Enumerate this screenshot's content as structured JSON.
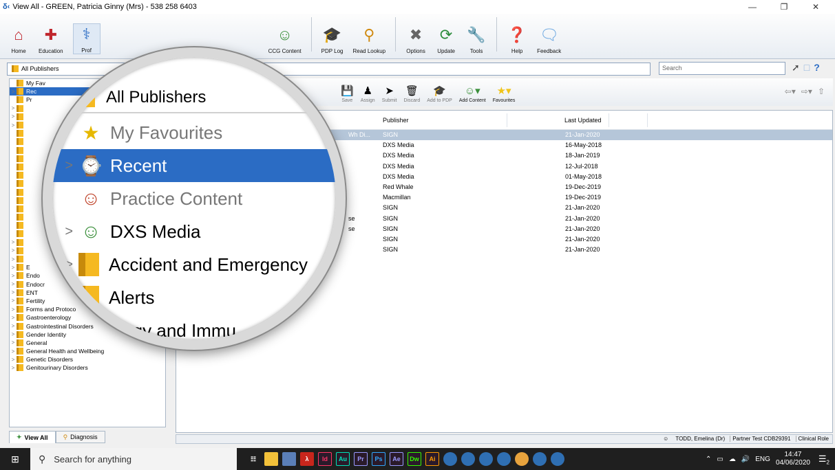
{
  "window": {
    "title": "View All  -  GREEN, Patricia Ginny (Mrs) - 538 258 6403",
    "app_logo": "δ‹"
  },
  "toolbar": {
    "buttons": [
      {
        "label": "Home",
        "icon": "home-icon"
      },
      {
        "label": "Education",
        "icon": "education-icon"
      },
      {
        "label": "Prof",
        "icon": "professional-icon"
      },
      {
        "label": "CCG Content",
        "icon": "ccg-content-icon"
      },
      {
        "label": "PDP Log",
        "icon": "pdp-log-icon"
      },
      {
        "label": "Read Lookup",
        "icon": "read-lookup-icon"
      },
      {
        "label": "Options",
        "icon": "options-icon"
      },
      {
        "label": "Update",
        "icon": "update-icon"
      },
      {
        "label": "Tools",
        "icon": "tools-icon"
      },
      {
        "label": "Help",
        "icon": "help-icon"
      },
      {
        "label": "Feedback",
        "icon": "feedback-icon"
      }
    ]
  },
  "address": {
    "text": "All Publishers",
    "search_placeholder": "Search"
  },
  "tree": {
    "items": [
      {
        "label": "My Fav",
        "expand": ""
      },
      {
        "label": "Rec",
        "expand": ">"
      },
      {
        "label": "Pr",
        "expand": ""
      },
      {
        "label": "",
        "expand": ">"
      },
      {
        "label": "",
        "expand": ">"
      },
      {
        "label": "",
        "expand": ">"
      },
      {
        "label": "",
        "expand": ""
      },
      {
        "label": "",
        "expand": ""
      },
      {
        "label": "",
        "expand": ""
      },
      {
        "label": "",
        "expand": ""
      },
      {
        "label": "",
        "expand": ""
      },
      {
        "label": "",
        "expand": ""
      },
      {
        "label": "",
        "expand": ""
      },
      {
        "label": "",
        "expand": ""
      },
      {
        "label": "",
        "expand": ""
      },
      {
        "label": "",
        "expand": ""
      },
      {
        "label": "",
        "expand": ""
      },
      {
        "label": "",
        "expand": ""
      },
      {
        "label": "",
        "expand": ""
      },
      {
        "label": "",
        "expand": ">"
      },
      {
        "label": "",
        "expand": ">"
      },
      {
        "label": "",
        "expand": ">"
      },
      {
        "label": "E",
        "expand": ">"
      },
      {
        "label": "Endo",
        "expand": ">"
      },
      {
        "label": "Endocr",
        "expand": ">"
      },
      {
        "label": "ENT",
        "expand": ">"
      },
      {
        "label": "Fertility",
        "expand": ">"
      },
      {
        "label": "Forms and Protoco",
        "expand": ">"
      },
      {
        "label": "Gastroenterology",
        "expand": ">"
      },
      {
        "label": "Gastrointestinal Disorders",
        "expand": ">"
      },
      {
        "label": "Gender Identity",
        "expand": ">"
      },
      {
        "label": "General",
        "expand": ">"
      },
      {
        "label": "General Health and Wellbeing",
        "expand": ">"
      },
      {
        "label": "Genetic Disorders",
        "expand": ">"
      },
      {
        "label": "Genitourinary Disorders",
        "expand": ">"
      }
    ]
  },
  "left_tabs": [
    {
      "label": "View All",
      "icon": "view-all-icon"
    },
    {
      "label": "Diagnosis",
      "icon": "diagnosis-icon"
    }
  ],
  "main_toolbar": {
    "buttons": [
      {
        "label": "Save",
        "enabled": false
      },
      {
        "label": "Assign",
        "enabled": false
      },
      {
        "label": "Submit",
        "enabled": false
      },
      {
        "label": "Discard",
        "enabled": false
      },
      {
        "label": "Add to PDP",
        "enabled": false
      },
      {
        "label": "Add Content",
        "enabled": true
      },
      {
        "label": "Favourites",
        "enabled": true
      }
    ]
  },
  "grid": {
    "columns": [
      "Publisher",
      "Last Updated"
    ],
    "rows": [
      {
        "lead": "Wh Di...",
        "publisher": "SIGN",
        "date": "21-Jan-2020",
        "selected": true
      },
      {
        "lead": "",
        "publisher": "DXS Media",
        "date": "16-May-2018"
      },
      {
        "lead": "",
        "publisher": "DXS Media",
        "date": "18-Jan-2019"
      },
      {
        "lead": "",
        "publisher": "DXS Media",
        "date": "12-Jul-2018"
      },
      {
        "lead": "",
        "publisher": "DXS Media",
        "date": "01-May-2018"
      },
      {
        "lead": "",
        "publisher": "Red Whale",
        "date": "19-Dec-2019"
      },
      {
        "lead": "",
        "publisher": "Macmillan",
        "date": "19-Dec-2019"
      },
      {
        "lead": "",
        "publisher": "SIGN",
        "date": "21-Jan-2020"
      },
      {
        "lead": "se",
        "publisher": "SIGN",
        "date": "21-Jan-2020"
      },
      {
        "lead": "se",
        "publisher": "SIGN",
        "date": "21-Jan-2020"
      },
      {
        "lead": "",
        "publisher": "SIGN",
        "date": "21-Jan-2020"
      },
      {
        "lead": "",
        "publisher": "SIGN",
        "date": "21-Jan-2020"
      }
    ]
  },
  "status": {
    "user": "TODD, Emelina (Dr)",
    "practice": "Partner Test CDB29391",
    "role": "Clinical Role"
  },
  "magnifier": {
    "header": "All Publishers",
    "rows": [
      {
        "label": "My Favourites",
        "icon": "favourites-icon",
        "expand": "",
        "state": "grey"
      },
      {
        "label": "Recent",
        "icon": "recent-clock-icon",
        "expand": ">",
        "state": "selected"
      },
      {
        "label": "Practice Content",
        "icon": "practice-content-icon",
        "expand": "",
        "state": "grey"
      },
      {
        "label": "DXS Media",
        "icon": "dxs-media-icon",
        "expand": ">",
        "state": ""
      },
      {
        "label": "Accident and Emergency",
        "icon": "folder-icon",
        "expand": ">",
        "state": ""
      },
      {
        "label": "Alerts",
        "icon": "folder-icon",
        "expand": "",
        "state": ""
      },
      {
        "label": "llergy and Immu",
        "icon": "folder-icon",
        "expand": "",
        "state": ""
      }
    ]
  },
  "taskbar": {
    "search_placeholder": "Search for anything",
    "apps": [
      "Id",
      "Au",
      "Pr",
      "Ps",
      "Ae",
      "Dw",
      "Ai"
    ],
    "lang": "ENG",
    "time": "14:47",
    "date": "04/06/2020",
    "notif_count": "2"
  }
}
